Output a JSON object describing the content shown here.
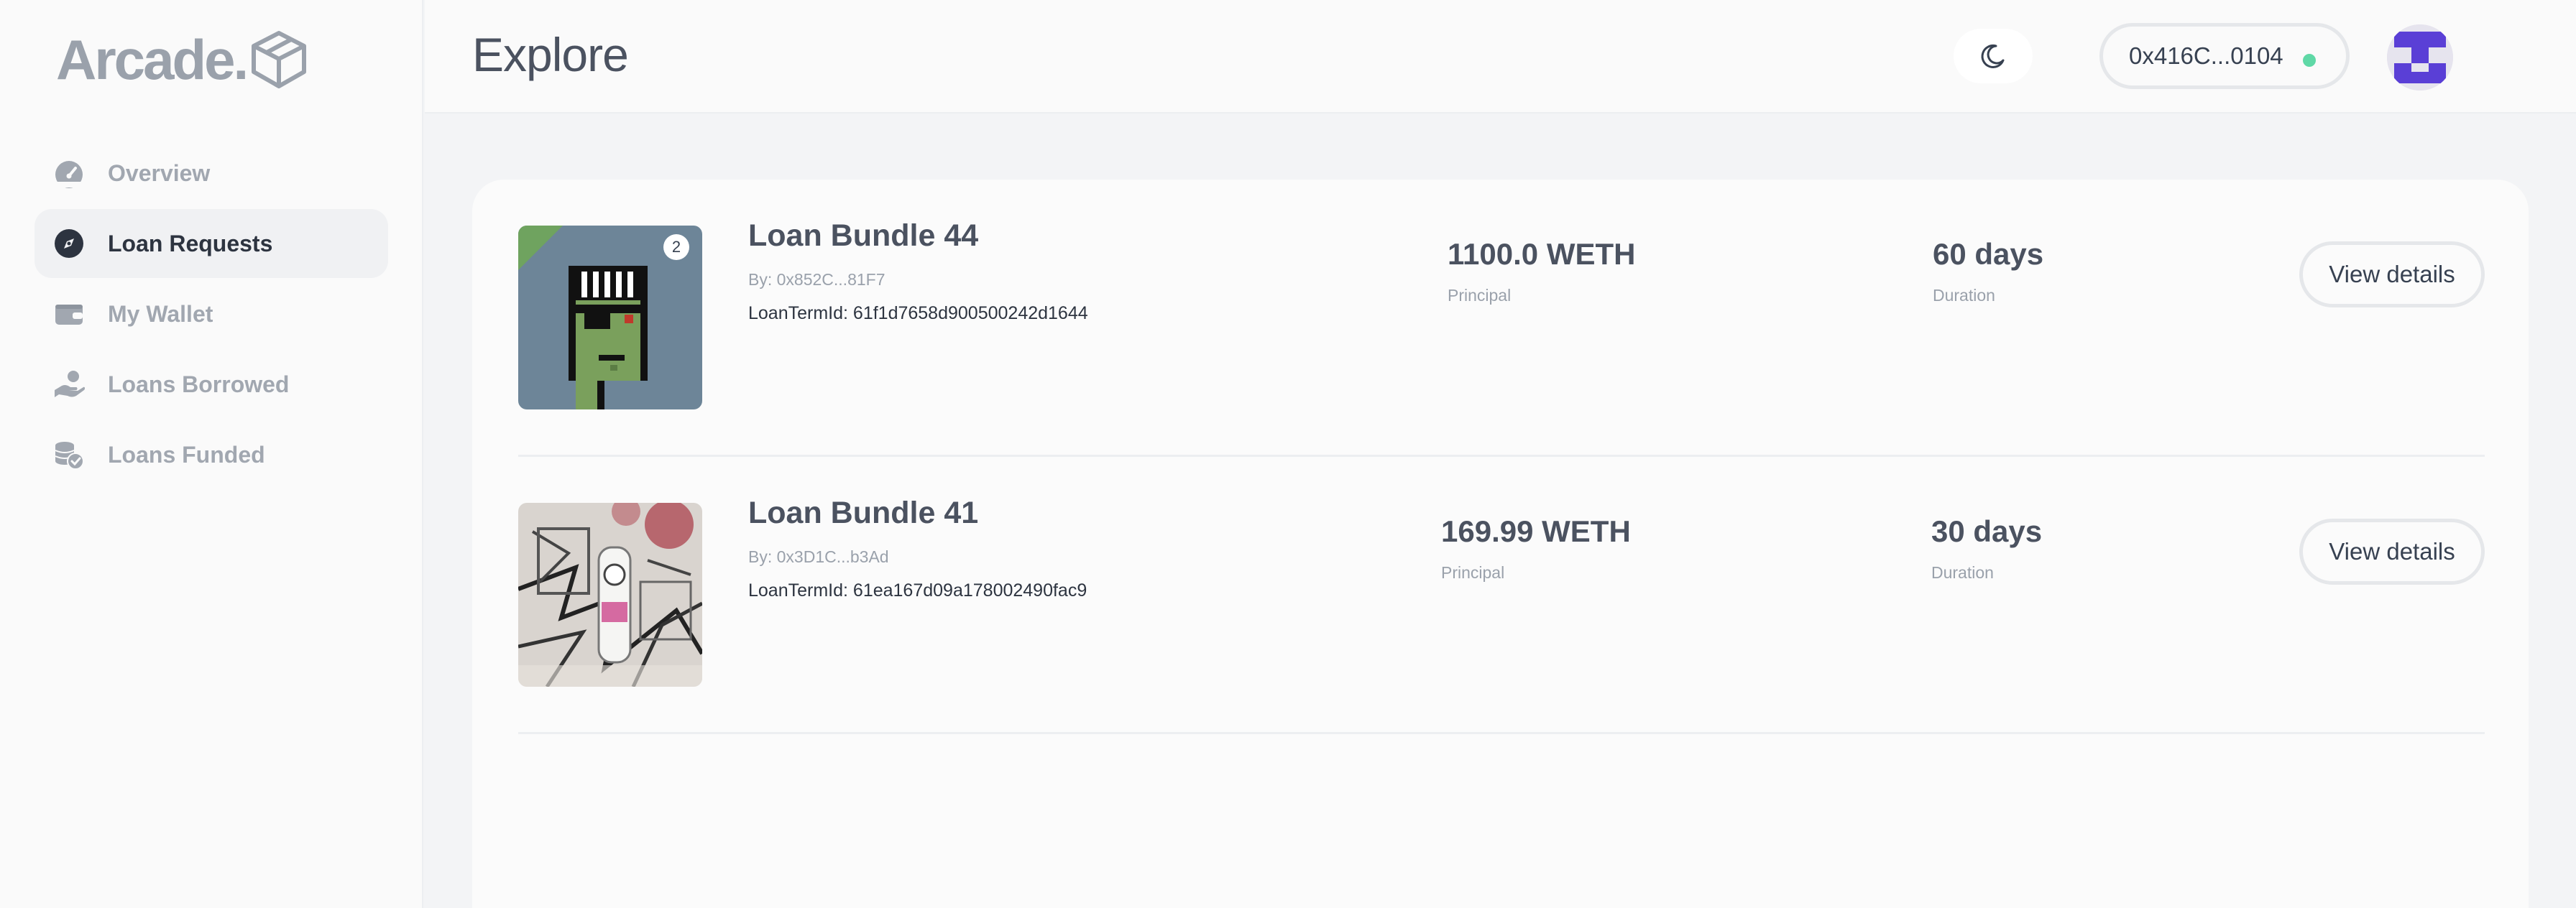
{
  "brand": {
    "logo_text": "Arcade."
  },
  "sidebar": {
    "items": [
      {
        "label": "Overview",
        "icon": "gauge-icon",
        "active": false
      },
      {
        "label": "Loan Requests",
        "icon": "compass-icon",
        "active": true
      },
      {
        "label": "My Wallet",
        "icon": "wallet-icon",
        "active": false
      },
      {
        "label": "Loans Borrowed",
        "icon": "hand-coin-icon",
        "active": false
      },
      {
        "label": "Loans Funded",
        "icon": "coins-check-icon",
        "active": false
      }
    ]
  },
  "header": {
    "title": "Explore",
    "theme_icon": "moon-icon",
    "wallet_address": "0x416C...0104",
    "wallet_status_color": "#5fd8a6",
    "avatar_color": "#5a3fd6"
  },
  "loans": [
    {
      "title": "Loan Bundle 44",
      "by": "By: 0x852C...81F7",
      "term_id": "LoanTermId: 61f1d7658d900500242d1644",
      "badge": "2",
      "principal_value": "1100.0 WETH",
      "principal_label": "Principal",
      "duration_value": "60 days",
      "duration_label": "Duration",
      "action_label": "View details"
    },
    {
      "title": "Loan Bundle 41",
      "by": "By: 0x3D1C...b3Ad",
      "term_id": "LoanTermId: 61ea167d09a178002490fac9",
      "principal_value": "169.99 WETH",
      "principal_label": "Principal",
      "duration_value": "30 days",
      "duration_label": "Duration",
      "action_label": "View details"
    }
  ]
}
